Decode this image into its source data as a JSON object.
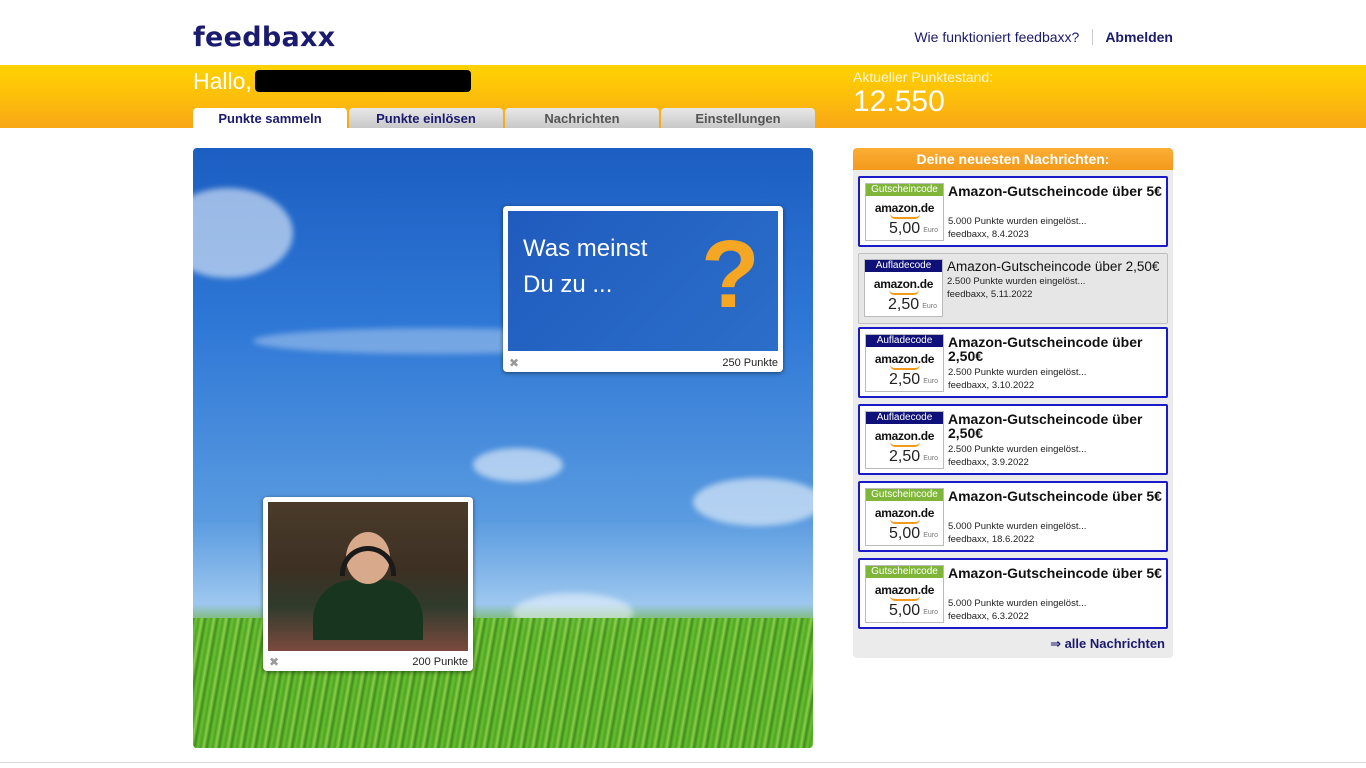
{
  "header": {
    "logo": "feedbaxx",
    "how_link": "Wie funktioniert feedbaxx?",
    "logout": "Abmelden"
  },
  "user": {
    "greeting": "Hallo,",
    "points_label": "Aktueller Punktestand:",
    "points_value": "12.550"
  },
  "tabs": [
    {
      "label": "Punkte sammeln",
      "active": true
    },
    {
      "label": "Punkte einlösen",
      "active": false
    },
    {
      "label": "Nachrichten",
      "active": false
    },
    {
      "label": "Einstellungen",
      "active": false
    }
  ],
  "stage": {
    "survey_card": {
      "text_line1": "Was meinst",
      "text_line2": "Du zu ...",
      "symbol": "?",
      "points": "250 Punkte",
      "close": "✖"
    },
    "video_card": {
      "points": "200 Punkte",
      "close": "✖"
    }
  },
  "messages_panel": {
    "title": "Deine neuesten Nachrichten:",
    "more_link": "⇒ alle Nachrichten",
    "items": [
      {
        "tag": "Gutscheincode",
        "brand": "amazon.de",
        "amount": "5,00",
        "currency": "Euro",
        "title": "Amazon-Gutscheincode über 5€",
        "line1": "5.000 Punkte wurden eingelöst...",
        "line2": "feedbaxx, 8.4.2023"
      },
      {
        "tag": "Aufladecode",
        "brand": "amazon.de",
        "amount": "2,50",
        "currency": "Euro",
        "title": "Amazon-Gutscheincode über 2,50€",
        "line1": "2.500 Punkte wurden eingelöst...",
        "line2": "feedbaxx, 5.11.2022"
      },
      {
        "tag": "Aufladecode",
        "brand": "amazon.de",
        "amount": "2,50",
        "currency": "Euro",
        "title": "Amazon-Gutscheincode über 2,50€",
        "line1": "2.500 Punkte wurden eingelöst...",
        "line2": "feedbaxx, 3.10.2022"
      },
      {
        "tag": "Aufladecode",
        "brand": "amazon.de",
        "amount": "2,50",
        "currency": "Euro",
        "title": "Amazon-Gutscheincode über 2,50€",
        "line1": "2.500 Punkte wurden eingelöst...",
        "line2": "feedbaxx, 3.9.2022"
      },
      {
        "tag": "Gutscheincode",
        "brand": "amazon.de",
        "amount": "5,00",
        "currency": "Euro",
        "title": "Amazon-Gutscheincode über 5€",
        "line1": "5.000 Punkte wurden eingelöst...",
        "line2": "feedbaxx, 18.6.2022"
      },
      {
        "tag": "Gutscheincode",
        "brand": "amazon.de",
        "amount": "5,00",
        "currency": "Euro",
        "title": "Amazon-Gutscheincode über 5€",
        "line1": "5.000 Punkte wurden eingelöst...",
        "line2": "feedbaxx, 6.3.2022"
      }
    ]
  },
  "colors": {
    "brand_navy": "#1a1a6e",
    "accent_orange": "#f39a1a",
    "unread_border": "#1a1ac8"
  }
}
